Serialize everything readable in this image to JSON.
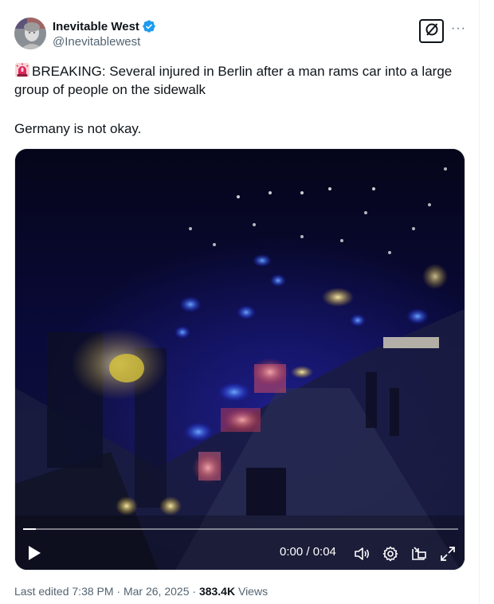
{
  "author": {
    "display_name": "Inevitable West",
    "handle": "@Inevitablewest",
    "verified": true,
    "verified_color": "#1d9bf0"
  },
  "header_actions": {
    "grok_icon": "grok-slash-circle-icon",
    "more_label": "···"
  },
  "tweet": {
    "emoji": "rotating-light-icon",
    "text_line1": "BREAKING: Several injured in Berlin after a man rams car into a large",
    "text_line2": "group of people on the sidewalk",
    "text_para2": "Germany is not okay."
  },
  "video": {
    "current_time": "0:00",
    "duration": "0:04",
    "time_display": "0:00 / 0:04",
    "progress": 0.03,
    "controls": [
      "play-icon",
      "volume-icon",
      "settings-icon",
      "pip-icon",
      "fullscreen-icon"
    ]
  },
  "meta": {
    "edited_prefix": "Last edited ",
    "time": "7:38 PM",
    "sep1": " · ",
    "date": "Mar 26, 2025",
    "sep2": " · ",
    "views_count": "383.4K",
    "views_label": " Views"
  }
}
